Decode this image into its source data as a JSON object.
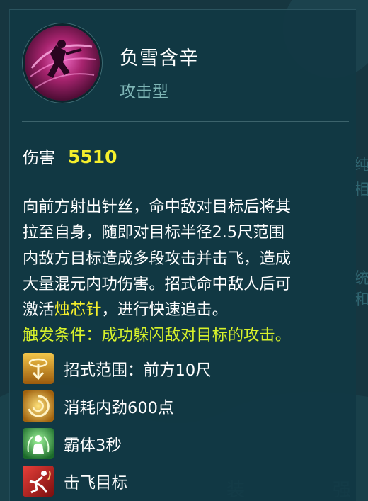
{
  "skill": {
    "name": "负雪含辛",
    "type": "攻击型"
  },
  "damage": {
    "label": "伤害",
    "value": "5510"
  },
  "description": {
    "line1": "向前方射出针丝，命中敌对目标后将其",
    "line2": "拉至自身，随即对目标半径2.5尺范围",
    "line3": "内敌方目标造成多段攻击并击飞，造成",
    "line4": "大量混元内功伤害。招式命中敌人后可",
    "line5_pre": "激活",
    "line5_highlight": "烛芯针",
    "line5_post": "，进行快速追击。",
    "trigger": "触发条件：成功躲闪敌对目标的攻击。"
  },
  "attributes": [
    {
      "icon": "range-arrow-icon",
      "label": "招式范围：前方10尺"
    },
    {
      "icon": "swirl-energy-icon",
      "label": "消耗内劲600点"
    },
    {
      "icon": "super-armor-icon",
      "label": "霸体3秒"
    },
    {
      "icon": "knockback-icon",
      "label": "击飞目标"
    }
  ],
  "colors": {
    "highlight": "#f5ef2c",
    "trigger": "#d8f22b",
    "type_label": "#7fb6b6",
    "panel": "#11384a"
  }
}
